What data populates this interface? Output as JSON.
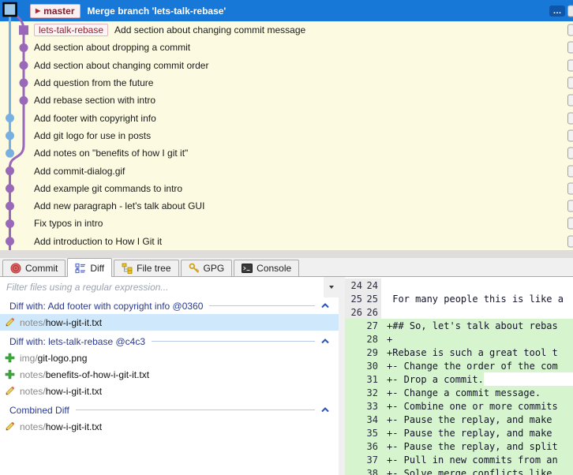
{
  "colors": {
    "selection_blue": "#1878d8",
    "graph_bg": "#fcfbe2",
    "lane_purple": "#9a68b8",
    "lane_blue": "#79b0e2",
    "head_node_fill": "#9ec9e8",
    "added_green": "#d6f4ce",
    "gutter_gray": "#ebebeb",
    "file_selected_blue": "#cfe8fb"
  },
  "commit_graph": {
    "head": {
      "badge_arrow": "▶",
      "branch_badge": "master",
      "message": "Merge branch 'lets-talk-rebase'",
      "more_label": "…"
    },
    "commits": [
      {
        "branch_label": "lets-talk-rebase",
        "message": "Add section about changing commit message",
        "lane": 1,
        "color": "lane_purple",
        "shape": "square"
      },
      {
        "message": "Add section about dropping a commit",
        "lane": 1,
        "color": "lane_purple",
        "shape": "circle"
      },
      {
        "message": "Add section about changing commit order",
        "lane": 1,
        "color": "lane_purple",
        "shape": "circle"
      },
      {
        "message": "Add question from the future",
        "lane": 1,
        "color": "lane_purple",
        "shape": "circle"
      },
      {
        "message": "Add rebase section with intro",
        "lane": 1,
        "color": "lane_purple",
        "shape": "circle"
      },
      {
        "message": "Add footer with copyright info",
        "lane": 0,
        "color": "lane_blue",
        "shape": "circle"
      },
      {
        "message": "Add git logo for use in posts",
        "lane": 0,
        "color": "lane_blue",
        "shape": "circle"
      },
      {
        "message": "Add notes on \"benefits of how I git it\"",
        "lane": 0,
        "color": "lane_blue",
        "shape": "circle"
      },
      {
        "message": "Add commit-dialog.gif",
        "lane": 0,
        "color": "lane_purple",
        "shape": "circle"
      },
      {
        "message": "Add example git commands to intro",
        "lane": 0,
        "color": "lane_purple",
        "shape": "circle"
      },
      {
        "message": "Add new paragraph - let's talk about GUI",
        "lane": 0,
        "color": "lane_purple",
        "shape": "circle"
      },
      {
        "message": "Fix typos in intro",
        "lane": 0,
        "color": "lane_purple",
        "shape": "circle"
      },
      {
        "message": "Add introduction to How I Git it",
        "lane": 0,
        "color": "lane_purple",
        "shape": "circle"
      }
    ]
  },
  "tabs": [
    {
      "label": "Commit",
      "icon": "commit-icon",
      "active": false
    },
    {
      "label": "Diff",
      "icon": "diff-icon",
      "active": true
    },
    {
      "label": "File tree",
      "icon": "file-tree-icon",
      "active": false
    },
    {
      "label": "GPG",
      "icon": "key-icon",
      "active": false
    },
    {
      "label": "Console",
      "icon": "console-icon",
      "active": false
    }
  ],
  "filter": {
    "placeholder": "Filter files using a regular expression..."
  },
  "file_sections": [
    {
      "title": "Diff with: Add footer with copyright info @0360",
      "files": [
        {
          "dir": "notes/",
          "name": "how-i-git-it.txt",
          "change": "modified",
          "selected": true
        }
      ]
    },
    {
      "title": "Diff with: lets-talk-rebase @c4c3",
      "files": [
        {
          "dir": "img/",
          "name": "git-logo.png",
          "change": "added"
        },
        {
          "dir": "notes/",
          "name": "benefits-of-how-i-git-it.txt",
          "change": "added"
        },
        {
          "dir": "notes/",
          "name": "how-i-git-it.txt",
          "change": "modified"
        }
      ]
    },
    {
      "title": "Combined Diff",
      "files": [
        {
          "dir": "notes/",
          "name": "how-i-git-it.txt",
          "change": "modified"
        }
      ]
    }
  ],
  "diff_view": {
    "lines": [
      {
        "old": "24",
        "new": "24",
        "text": "",
        "type": "context"
      },
      {
        "old": "25",
        "new": "25",
        "text": " For many people this is like a",
        "type": "context"
      },
      {
        "old": "26",
        "new": "26",
        "text": "",
        "type": "context"
      },
      {
        "old": "",
        "new": "27",
        "text": "+## So, let's talk about rebas",
        "type": "added"
      },
      {
        "old": "",
        "new": "28",
        "text": "+",
        "type": "added"
      },
      {
        "old": "",
        "new": "29",
        "text": "+Rebase is such a great tool t",
        "type": "added"
      },
      {
        "old": "",
        "new": "30",
        "text": "+- Change the order of the com",
        "type": "added"
      },
      {
        "old": "",
        "new": "31",
        "text": "+- Drop a commit.",
        "type": "added",
        "trail": "white"
      },
      {
        "old": "",
        "new": "32",
        "text": "+- Change a commit message.",
        "type": "added"
      },
      {
        "old": "",
        "new": "33",
        "text": "+- Combine one or more commits",
        "type": "added"
      },
      {
        "old": "",
        "new": "34",
        "text": "+- Pause the replay, and make ",
        "type": "added"
      },
      {
        "old": "",
        "new": "35",
        "text": "+- Pause the replay, and make ",
        "type": "added"
      },
      {
        "old": "",
        "new": "36",
        "text": "+- Pause the replay, and split",
        "type": "added"
      },
      {
        "old": "",
        "new": "37",
        "text": "+- Pull in new commits from an",
        "type": "added"
      },
      {
        "old": "",
        "new": "38",
        "text": "+- Solve merge conflicts like ",
        "type": "added"
      }
    ]
  }
}
